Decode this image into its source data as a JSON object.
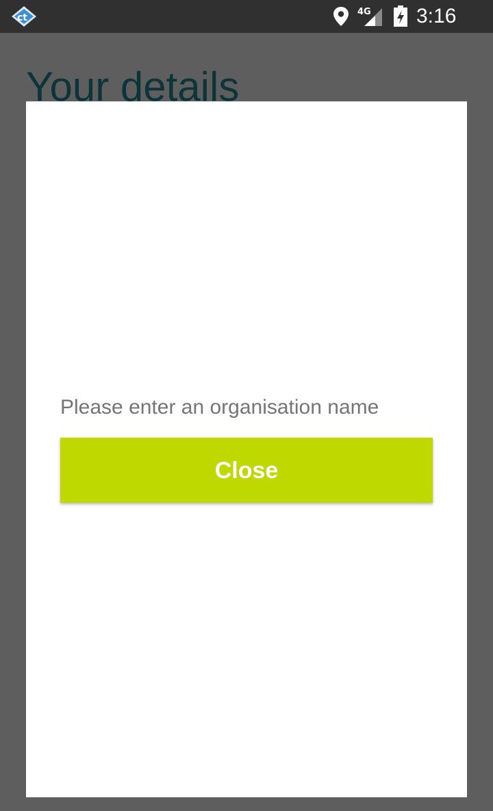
{
  "status_bar": {
    "network_type": "4G",
    "time": "3:16",
    "icons": [
      "app-logo-icon",
      "location-pin-icon",
      "cell-signal-icon",
      "battery-charging-icon"
    ]
  },
  "background_page": {
    "title": "Your details"
  },
  "dialog": {
    "message": "Please enter an organisation name",
    "close_label": "Close",
    "button_color": "#bfd900"
  },
  "colors": {
    "overlay": "#5e5e5e",
    "status_bar": "#303030",
    "title": "#0d3438",
    "message_text": "#757575"
  }
}
